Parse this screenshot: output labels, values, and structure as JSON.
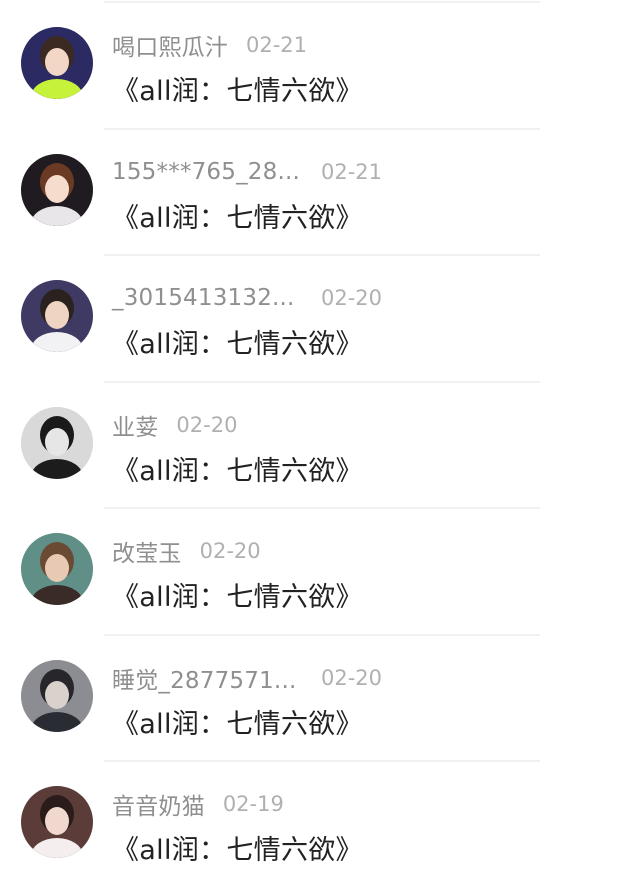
{
  "comments": [
    {
      "username": "喝口熙瓜汁",
      "date": "02-21",
      "message": "《all润：七情六欲》",
      "avatar": {
        "bg": "#2b2a63",
        "accent": "#c6f23a",
        "skin": "#f2d6c6",
        "hair": "#3a2a22"
      }
    },
    {
      "username": "155***765_28...",
      "date": "02-21",
      "message": "《all润：七情六欲》",
      "avatar": {
        "bg": "#1f1b20",
        "accent": "#e9e6ea",
        "skin": "#f5dccc",
        "hair": "#6a3a22"
      }
    },
    {
      "username": "_3015413132...",
      "date": "02-20",
      "message": "《all润：七情六欲》",
      "avatar": {
        "bg": "#3f3a63",
        "accent": "#f2f2f4",
        "skin": "#efd4c2",
        "hair": "#2b2220"
      }
    },
    {
      "username": "业荽",
      "date": "02-20",
      "message": "《all润：七情六欲》",
      "avatar": {
        "bg": "#d9d9d9",
        "accent": "#1c1c1c",
        "skin": "#e6e6e6",
        "hair": "#1a1a1a"
      }
    },
    {
      "username": "改莹玉",
      "date": "02-20",
      "message": "《all润：七情六欲》",
      "avatar": {
        "bg": "#5f8f86",
        "accent": "#3a2a28",
        "skin": "#e8c9b4",
        "hair": "#6b4a34"
      }
    },
    {
      "username": "睡觉_2877571...",
      "date": "02-20",
      "message": "《all润：七情六欲》",
      "avatar": {
        "bg": "#8c8d93",
        "accent": "#2a2c34",
        "skin": "#d9d2cc",
        "hair": "#26262b"
      }
    },
    {
      "username": "音音奶猫",
      "date": "02-19",
      "message": "《all润：七情六欲》",
      "avatar": {
        "bg": "#5c3c38",
        "accent": "#f4eeee",
        "skin": "#f1d8cf",
        "hair": "#2a1c1a"
      }
    }
  ]
}
